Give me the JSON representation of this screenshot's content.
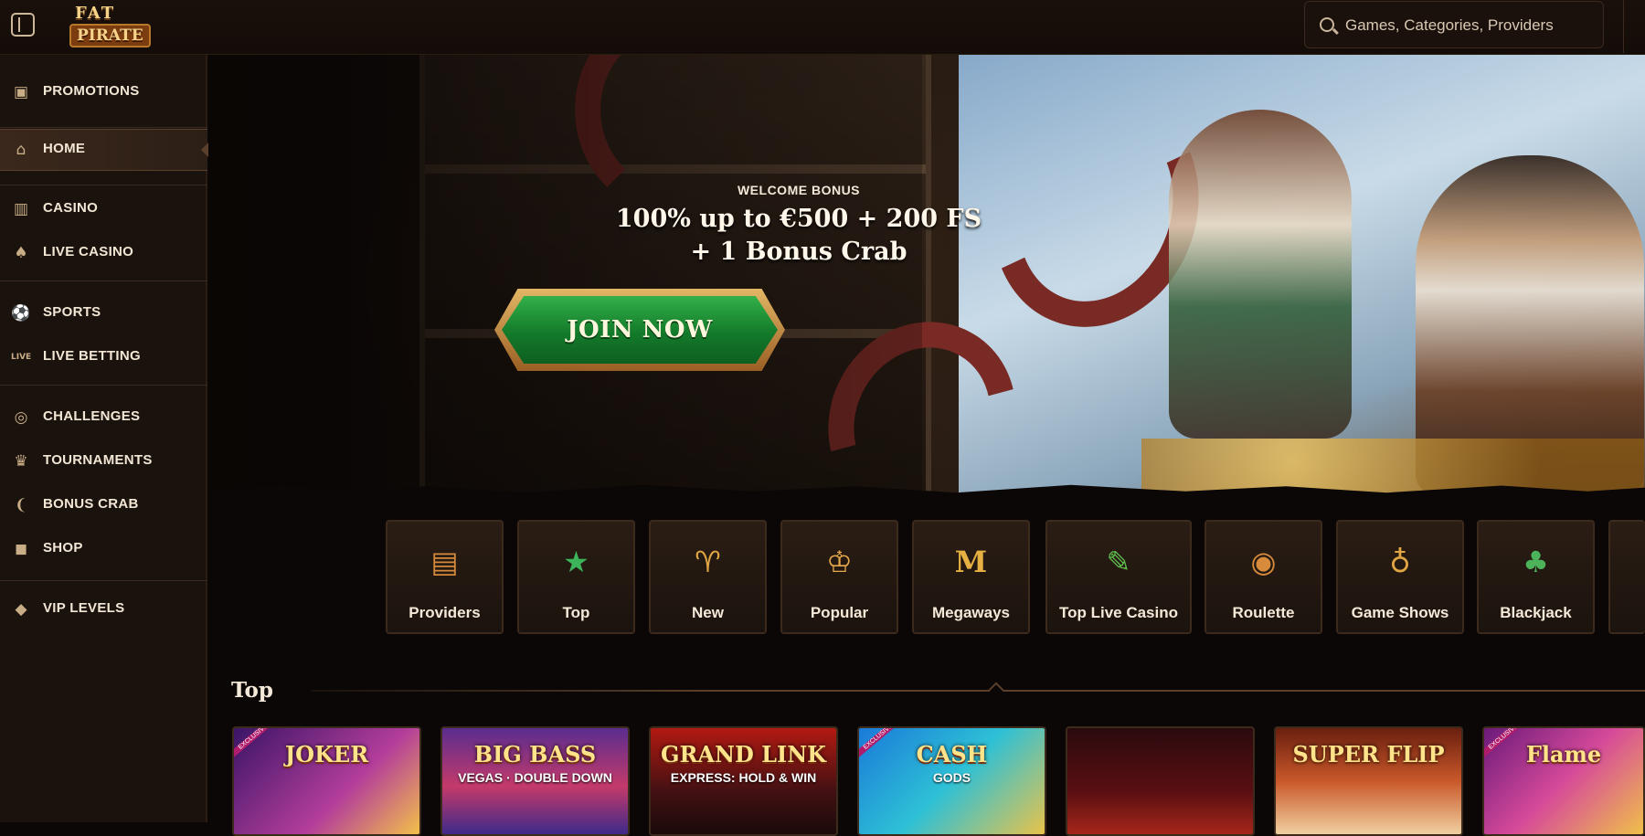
{
  "header": {
    "logo_line1": "FAT",
    "logo_line2": "PIRATE",
    "search_placeholder": "Games, Categories, Providers"
  },
  "sidebar": {
    "items": [
      {
        "label": "PROMOTIONS",
        "icon": "treasure-chest-icon",
        "active": false
      },
      {
        "label": "HOME",
        "icon": "house-icon",
        "active": true
      },
      {
        "label": "CASINO",
        "icon": "slot-machine-icon",
        "active": false
      },
      {
        "label": "LIVE CASINO",
        "icon": "cards-icon",
        "active": false
      },
      {
        "label": "SPORTS",
        "icon": "football-icon",
        "active": false
      },
      {
        "label": "LIVE BETTING",
        "icon": "live-icon",
        "active": false
      },
      {
        "label": "CHALLENGES",
        "icon": "medal-icon",
        "active": false
      },
      {
        "label": "TOURNAMENTS",
        "icon": "trophy-icon",
        "active": false
      },
      {
        "label": "BONUS CRAB",
        "icon": "crab-icon",
        "active": false
      },
      {
        "label": "SHOP",
        "icon": "shopping-bag-icon",
        "active": false
      },
      {
        "label": "VIP LEVELS",
        "icon": "diamond-icon",
        "active": false
      }
    ]
  },
  "hero": {
    "eyebrow": "WELCOME BONUS",
    "headline_line1": "100% up to €500 + 200 FS",
    "headline_line2": "+ 1 Bonus Crab",
    "cta_label": "JOIN NOW"
  },
  "categories": [
    {
      "label": "Providers",
      "icon": "scroll-map-icon"
    },
    {
      "label": "Top",
      "icon": "star-icon"
    },
    {
      "label": "New",
      "icon": "goblet-icon"
    },
    {
      "label": "Popular",
      "icon": "crown-gem-icon"
    },
    {
      "label": "Megaways",
      "icon": "letter-m-icon"
    },
    {
      "label": "Top Live Casino",
      "icon": "torch-icon"
    },
    {
      "label": "Roulette",
      "icon": "roulette-wheel-icon"
    },
    {
      "label": "Game Shows",
      "icon": "globe-trophy-icon"
    },
    {
      "label": "Blackjack",
      "icon": "playing-cards-icon"
    }
  ],
  "top_section": {
    "title": "Top",
    "games": [
      {
        "title": "JOKER",
        "subtitle": "",
        "badge": "EXCLUSIVE"
      },
      {
        "title": "BIG BASS",
        "subtitle": "VEGAS · DOUBLE DOWN",
        "badge": ""
      },
      {
        "title": "GRAND LINK",
        "subtitle": "EXPRESS: HOLD & WIN",
        "badge": ""
      },
      {
        "title": "CASH",
        "subtitle": "GODS",
        "badge": "EXCLUSIVE"
      },
      {
        "title": "",
        "subtitle": "",
        "badge": ""
      },
      {
        "title": "SUPER FLIP",
        "subtitle": "",
        "badge": ""
      },
      {
        "title": "Flame",
        "subtitle": "",
        "badge": "EXCLUSIVE"
      }
    ]
  },
  "colors": {
    "background": "#0b0706",
    "sidebar": "#1a120d",
    "accent_gold": "#e3b665",
    "cta_green": "#137a2a"
  }
}
